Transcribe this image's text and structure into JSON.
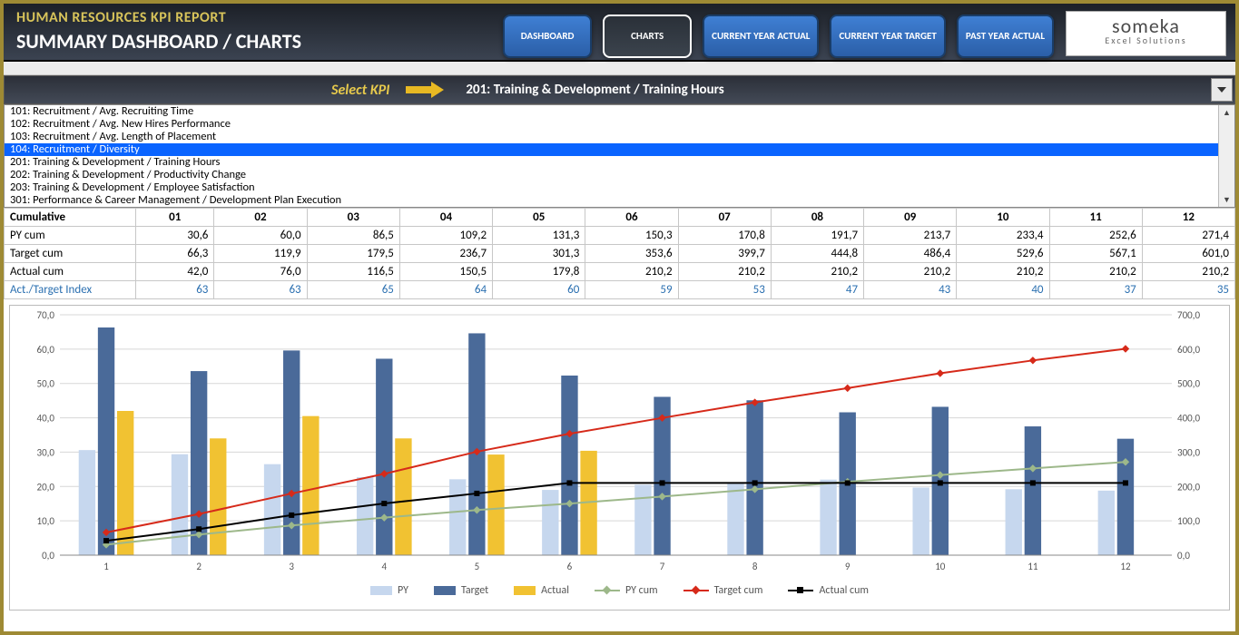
{
  "header": {
    "title": "HUMAN RESOURCES KPI REPORT",
    "subtitle": "SUMMARY DASHBOARD / CHARTS"
  },
  "nav": [
    "DASHBOARD",
    "CHARTS",
    "CURRENT YEAR ACTUAL",
    "CURRENT YEAR TARGET",
    "PAST YEAR ACTUAL"
  ],
  "logo": {
    "big": "someka",
    "small": "Excel Solutions"
  },
  "selector": {
    "label": "Select KPI",
    "value": "201: Training & Development / Training Hours"
  },
  "options": [
    "101: Recruitment / Avg. Recruiting Time",
    "102: Recruitment / Avg. New Hires Performance",
    "103: Recruitment / Avg. Length of Placement",
    "104: Recruitment / Diversity",
    "201: Training & Development / Training Hours",
    "202: Training & Development / Productivity Change",
    "203: Training & Development / Employee Satisfaction",
    "301: Performance & Career Management / Development Plan Execution"
  ],
  "table": {
    "head": "Cumulative",
    "months": [
      "01",
      "02",
      "03",
      "04",
      "05",
      "06",
      "07",
      "08",
      "09",
      "10",
      "11",
      "12"
    ],
    "rows": [
      {
        "label": "PY cum",
        "v": [
          "30,6",
          "60,0",
          "86,5",
          "109,2",
          "131,3",
          "150,3",
          "170,8",
          "191,7",
          "213,7",
          "233,4",
          "252,6",
          "271,4"
        ]
      },
      {
        "label": "Target cum",
        "v": [
          "66,3",
          "119,9",
          "179,5",
          "236,7",
          "301,3",
          "353,6",
          "399,7",
          "444,8",
          "486,4",
          "529,6",
          "567,1",
          "601,0"
        ]
      },
      {
        "label": "Actual cum",
        "v": [
          "42,0",
          "76,0",
          "116,5",
          "150,5",
          "179,8",
          "210,2",
          "210,2",
          "210,2",
          "210,2",
          "210,2",
          "210,2",
          "210,2"
        ]
      },
      {
        "label": "Act./Target Index",
        "v": [
          "63",
          "63",
          "65",
          "64",
          "60",
          "59",
          "53",
          "47",
          "43",
          "40",
          "37",
          "35"
        ]
      }
    ]
  },
  "chart_data": {
    "type": "combo",
    "categories": [
      "1",
      "2",
      "3",
      "4",
      "5",
      "6",
      "7",
      "8",
      "9",
      "10",
      "11",
      "12"
    ],
    "y1": {
      "min": 0,
      "max": 70,
      "step": 10,
      "labels": [
        "0,0",
        "10,0",
        "20,0",
        "30,0",
        "40,0",
        "50,0",
        "60,0",
        "70,0"
      ]
    },
    "y2": {
      "min": 0,
      "max": 700,
      "step": 100,
      "labels": [
        "0,0",
        "100,0",
        "200,0",
        "300,0",
        "400,0",
        "500,0",
        "600,0",
        "700,0"
      ]
    },
    "series": [
      {
        "name": "PY",
        "type": "bar",
        "axis": "y1",
        "color": "#c6d7ee",
        "values": [
          30.6,
          29.4,
          26.5,
          22.7,
          22.1,
          19.0,
          20.5,
          20.9,
          22.0,
          19.7,
          19.2,
          18.8
        ]
      },
      {
        "name": "Target",
        "type": "bar",
        "axis": "y1",
        "color": "#4a6a99",
        "values": [
          66.3,
          53.6,
          59.6,
          57.2,
          64.6,
          52.3,
          46.1,
          45.1,
          41.6,
          43.2,
          37.5,
          33.9
        ]
      },
      {
        "name": "Actual",
        "type": "bar",
        "axis": "y1",
        "color": "#f1c232",
        "values": [
          42.0,
          34.0,
          40.5,
          34.0,
          29.3,
          30.4,
          0,
          0,
          0,
          0,
          0,
          0
        ]
      },
      {
        "name": "PY cum",
        "type": "line",
        "axis": "y2",
        "color": "#9db88a",
        "values": [
          30.6,
          60.0,
          86.5,
          109.2,
          131.3,
          150.3,
          170.8,
          191.7,
          213.7,
          233.4,
          252.6,
          271.4
        ]
      },
      {
        "name": "Target cum",
        "type": "line",
        "axis": "y2",
        "color": "#d62a1a",
        "values": [
          66.3,
          119.9,
          179.5,
          236.7,
          301.3,
          353.6,
          399.7,
          444.8,
          486.4,
          529.6,
          567.1,
          601.0
        ]
      },
      {
        "name": "Actual cum",
        "type": "line",
        "axis": "y2",
        "color": "#000000",
        "values": [
          42.0,
          76.0,
          116.5,
          150.5,
          179.8,
          210.2,
          210.2,
          210.2,
          210.2,
          210.2,
          210.2,
          210.2
        ]
      }
    ]
  }
}
